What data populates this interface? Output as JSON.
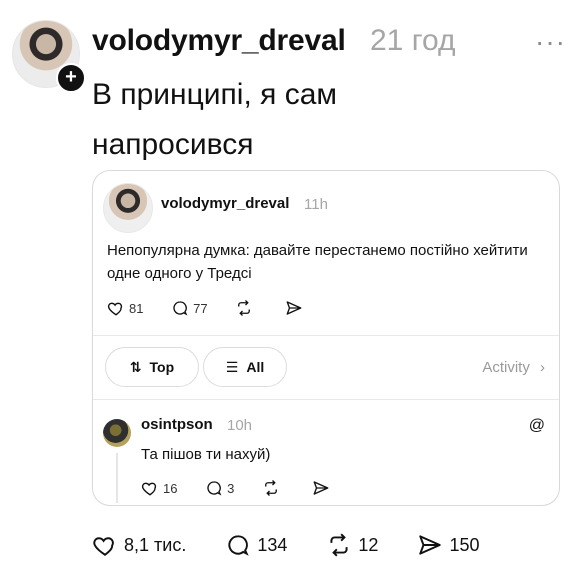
{
  "post": {
    "username": "volodymyr_dreval",
    "time": "21 год",
    "more": "···",
    "text": "В принципі, я сам напросився",
    "stats": {
      "likes": "8,1 тис.",
      "comments": "134",
      "reposts": "12",
      "shares": "150"
    }
  },
  "embedded": {
    "username": "volodymyr_dreval",
    "time": "11h",
    "text": "Непопулярна думка: давайте перестанемо постійно хейтити одне одного у Тредсі",
    "stats": {
      "likes": "81",
      "comments": "77"
    },
    "filters": {
      "top": "Top",
      "all": "All",
      "activity": "Activity"
    },
    "reply": {
      "username": "osintpson",
      "time": "10h",
      "text": "Та пішов ти нахуй)",
      "stats": {
        "likes": "16",
        "comments": "3"
      }
    }
  },
  "colors": {
    "text": "#111111",
    "muted": "#a6a6a6",
    "border": "#d9d9d9",
    "badge": "#111111"
  },
  "icons": {
    "like": "heart-icon",
    "comment": "comment-icon",
    "repost": "repost-icon",
    "share": "share-icon",
    "threads": "threads-icon",
    "more": "more-icon",
    "add": "plus-icon"
  }
}
